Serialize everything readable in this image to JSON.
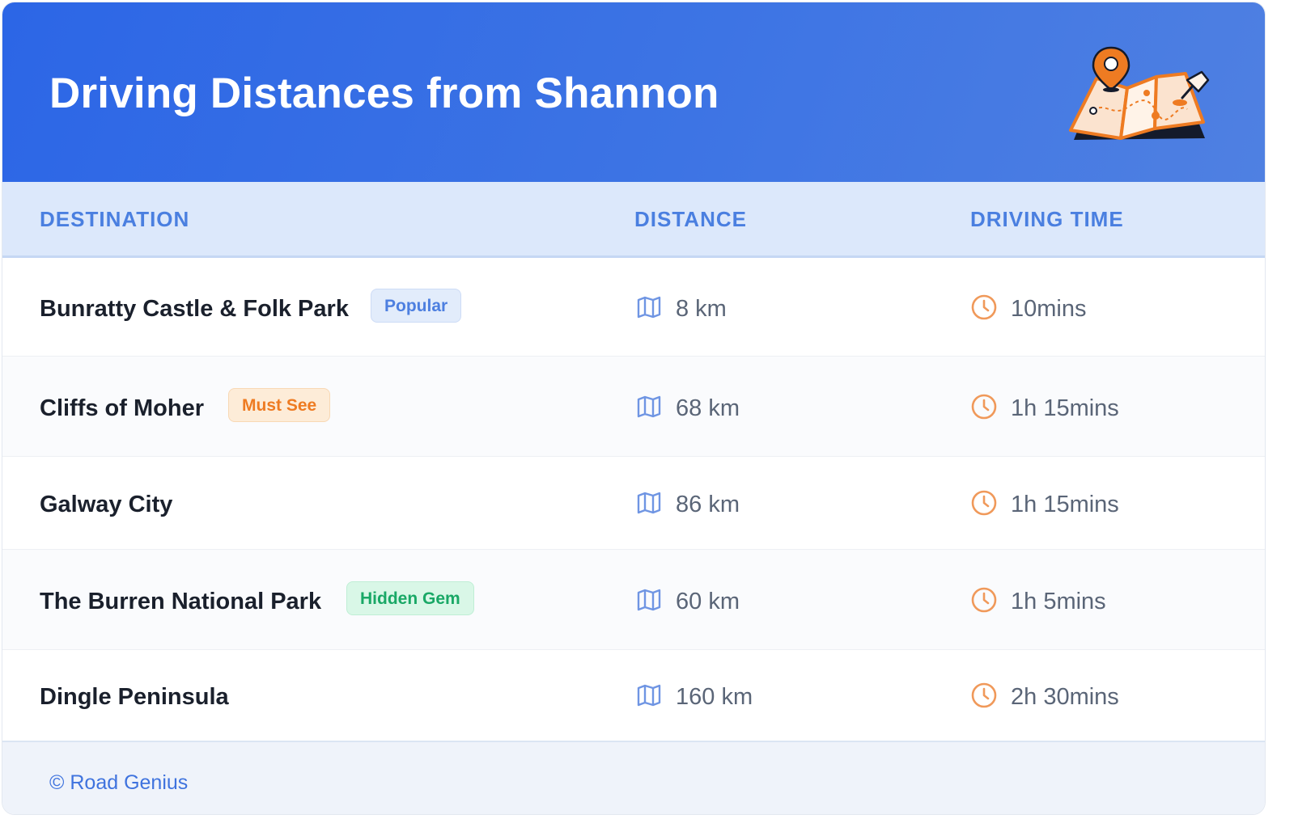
{
  "header": {
    "title": "Driving Distances from Shannon",
    "illustration_icon": "map-with-pins-icon"
  },
  "table": {
    "columns": [
      "DESTINATION",
      "DISTANCE",
      "DRIVING TIME"
    ],
    "distance_icon": "map-icon",
    "time_icon": "clock-icon",
    "rows": [
      {
        "destination": "Bunratty Castle & Folk Park",
        "badge": "Popular",
        "badge_color": "#4d7fe0",
        "distance": "8 km",
        "time": "10mins"
      },
      {
        "destination": "Cliffs of Moher",
        "badge": "Must See",
        "badge_color": "#ee7b22",
        "distance": "68 km",
        "time": "1h 15mins"
      },
      {
        "destination": "Galway City",
        "badge": "",
        "distance": "86 km",
        "time": "1h 15mins"
      },
      {
        "destination": "The Burren National Park",
        "badge": "Hidden Gem",
        "badge_color": "#19a866",
        "distance": "60 km",
        "time": "1h 5mins"
      },
      {
        "destination": "Dingle Peninsula",
        "badge": "",
        "distance": "160 km",
        "time": "2h 30mins"
      }
    ]
  },
  "footer": {
    "copyright": "© Road Genius"
  },
  "colors": {
    "header_start": "#2c66e6",
    "header_end": "#4f80e2",
    "column_header_text": "#4a7fe0",
    "icon_map": "#6f95e3",
    "icon_clock": "#f0995a",
    "footer_text": "#3f73de"
  }
}
